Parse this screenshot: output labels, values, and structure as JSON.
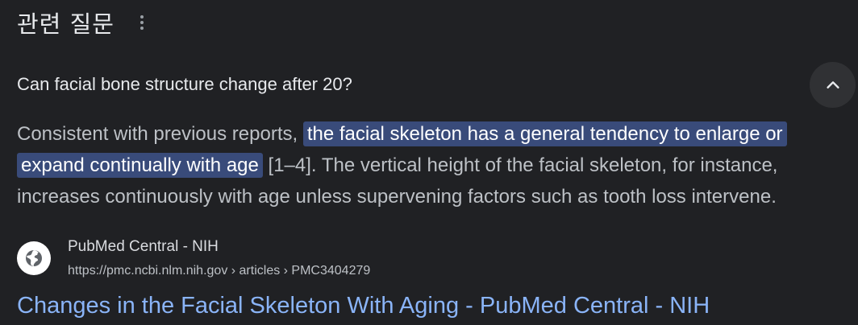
{
  "header": {
    "title": "관련 질문",
    "more_icon": "vertical-dots-icon"
  },
  "question": {
    "text": "Can facial bone structure change after 20?",
    "toggle_icon": "chevron-up-icon"
  },
  "answer": {
    "before": "Consistent with previous reports, ",
    "highlight": "the facial skeleton has a general tendency to enlarge or expand continually with age",
    "after": " [1–4]. The vertical height of the facial skeleton, for instance, increases continuously with age unless supervening factors such as tooth loss intervene."
  },
  "source": {
    "icon": "globe-icon",
    "name": "PubMed Central - NIH",
    "url": "https://pmc.ncbi.nlm.nih.gov › articles › PMC3404279"
  },
  "result": {
    "title": "Changes in the Facial Skeleton With Aging - PubMed Central - NIH"
  },
  "colors": {
    "background": "#202124",
    "highlight": "#394b7a",
    "link": "#8ab4f8"
  }
}
